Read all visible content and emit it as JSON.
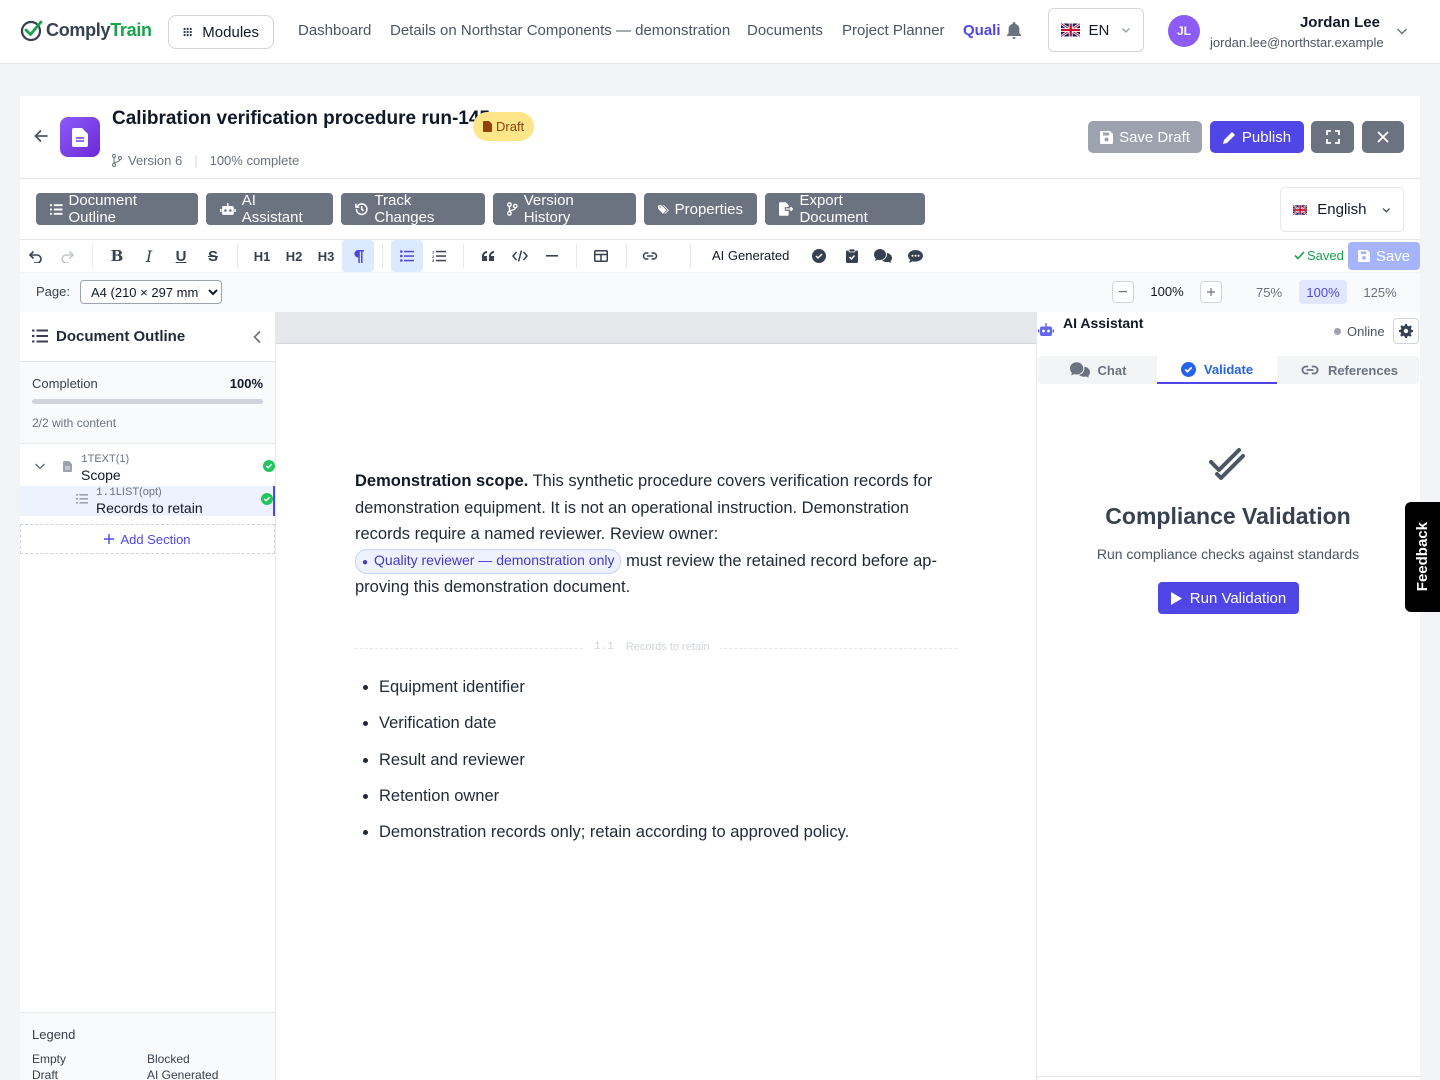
{
  "topnav": {
    "logo_part1": "Comply",
    "logo_part2": "Train",
    "modules_label": "Modules",
    "links": [
      {
        "label": "Dashboard"
      },
      {
        "label": "Details on Northstar Components — demonstration"
      },
      {
        "label": "Documents"
      },
      {
        "label": "Project Planner"
      },
      {
        "label": "Quali"
      }
    ],
    "language": "EN",
    "user_initials": "JL",
    "user_name": "Jordan Lee",
    "user_email": "jordan.lee@northstar.example"
  },
  "document": {
    "title": "Calibration verification procedure run-145",
    "status_badge": "Draft",
    "version": "Version 6",
    "progress_text": "100% complete"
  },
  "header_actions": {
    "save_draft": "Save Draft",
    "publish": "Publish"
  },
  "toolbar": {
    "buttons": [
      {
        "label": "Document Outline"
      },
      {
        "label": "AI Assistant"
      },
      {
        "label": "Track Changes"
      },
      {
        "label": "Version History"
      },
      {
        "label": "Properties"
      },
      {
        "label": "Export Document"
      }
    ],
    "language": "English"
  },
  "format_toolbar": {
    "h1": "H1",
    "h2": "H2",
    "h3": "H3",
    "ai_generated": "AI Generated",
    "saved_status": "Saved",
    "save_button": "Save"
  },
  "page_bar": {
    "page_label": "Page:",
    "page_size": "A4 (210 × 297 mm)",
    "page_size_options": [
      "A4 (210 × 297 mm)"
    ],
    "zoom_value": "100%",
    "zoom_presets": [
      "75%",
      "100%",
      "125%"
    ]
  },
  "outline": {
    "title": "Document Outline",
    "completion_label": "Completion",
    "completion_value": "100%",
    "completion_fraction": 1.0,
    "content_count": "2/2 with content",
    "sections": [
      {
        "number": "1",
        "type": "TEXT(1)",
        "title": "Scope"
      },
      {
        "number": "1.1",
        "type": "LIST(opt)",
        "title": "Records to retain"
      }
    ],
    "add_section": "Add Section",
    "legend_title": "Legend",
    "legend_items": [
      "Empty",
      "Blocked",
      "Draft",
      "AI Generated"
    ]
  },
  "editor": {
    "scope_heading": "Demonstration scope.",
    "scope_text": " This synthetic procedure covers verification records for demonstration equipment. It is not an operational instruction. Demonstration records require a named reviewer. Review owner: ",
    "tag_label": "Quality reviewer — demonstration only",
    "scope_tail": " must review the retained record before ap­proving this demonstration document.",
    "section_divider_number": "1.1",
    "section_divider_title": "Records to retain",
    "list_items": [
      "Equipment identifier",
      "Verification date",
      "Result and reviewer",
      "Retention owner",
      "Demonstration records only; retain according to approved policy."
    ]
  },
  "ai_panel": {
    "title": "AI Assistant",
    "status": "Online",
    "tabs": [
      {
        "label": "Chat"
      },
      {
        "label": "Validate"
      },
      {
        "label": "References"
      }
    ],
    "validation_title": "Compliance Validation",
    "validation_subtitle": "Run compliance checks against standards",
    "run_button": "Run Validation"
  },
  "feedback_tab": "Feedback",
  "colors": {
    "primary": "#4f46e5",
    "success": "#22c55e",
    "draft_badge": "#fde68a",
    "toolbar_button": "#6b7280"
  }
}
